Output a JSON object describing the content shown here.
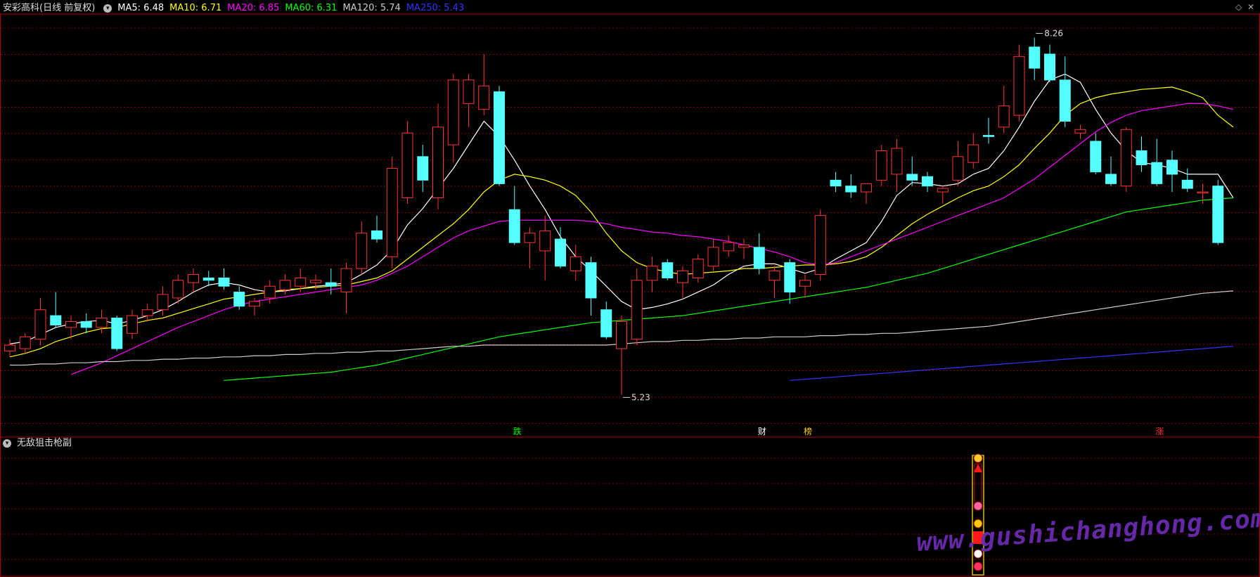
{
  "header": {
    "stock_title": "安彩高科(日线 前复权)",
    "ma_labels": [
      {
        "text": "MA5: 6.48",
        "color": "#ffffff"
      },
      {
        "text": "MA10: 6.71",
        "color": "#ffff00"
      },
      {
        "text": "MA20: 6.85",
        "color": "#ff00ff"
      },
      {
        "text": "MA60: 6.31",
        "color": "#00ff00"
      },
      {
        "text": "MA120: 5.74",
        "color": "#cccccc"
      },
      {
        "text": "MA250: 5.43",
        "color": "#3333ff"
      }
    ]
  },
  "sub_panel": {
    "title": "无敌狙击枪副"
  },
  "watermark": "www.gushichanghong.com",
  "icons": {
    "toggle": "chevron-down-icon",
    "window_controls": [
      "diamond-icon",
      "close-icon"
    ]
  },
  "colors": {
    "up": "#ff3333",
    "down": "#54ffff",
    "grid": "#8b0000",
    "border": "#b00000"
  },
  "chart_data": {
    "type": "candlestick",
    "ylim": [
      5.0,
      8.4
    ],
    "grid": true,
    "annotations": [
      {
        "text": "8.26",
        "note": "high"
      },
      {
        "text": "5.23",
        "note": "low"
      },
      {
        "text": "跌",
        "color": "#00ff00"
      },
      {
        "text": "财",
        "color": "#ffffff"
      },
      {
        "text": "榜",
        "color": "#ffcc00"
      },
      {
        "text": "涨",
        "color": "#ff3333"
      }
    ],
    "candles": [
      {
        "o": 5.6,
        "h": 5.7,
        "l": 5.55,
        "c": 5.65
      },
      {
        "o": 5.62,
        "h": 5.75,
        "l": 5.58,
        "c": 5.72
      },
      {
        "o": 5.7,
        "h": 6.05,
        "l": 5.65,
        "c": 5.95
      },
      {
        "o": 5.9,
        "h": 6.1,
        "l": 5.8,
        "c": 5.82
      },
      {
        "o": 5.8,
        "h": 5.9,
        "l": 5.7,
        "c": 5.85
      },
      {
        "o": 5.85,
        "h": 5.92,
        "l": 5.75,
        "c": 5.8
      },
      {
        "o": 5.8,
        "h": 5.95,
        "l": 5.75,
        "c": 5.88
      },
      {
        "o": 5.88,
        "h": 5.9,
        "l": 5.6,
        "c": 5.62
      },
      {
        "o": 5.75,
        "h": 5.95,
        "l": 5.7,
        "c": 5.9
      },
      {
        "o": 5.9,
        "h": 6.0,
        "l": 5.85,
        "c": 5.95
      },
      {
        "o": 5.95,
        "h": 6.15,
        "l": 5.9,
        "c": 6.08
      },
      {
        "o": 6.05,
        "h": 6.25,
        "l": 6.0,
        "c": 6.2
      },
      {
        "o": 6.18,
        "h": 6.3,
        "l": 6.1,
        "c": 6.25
      },
      {
        "o": 6.22,
        "h": 6.28,
        "l": 6.15,
        "c": 6.2
      },
      {
        "o": 6.22,
        "h": 6.3,
        "l": 6.12,
        "c": 6.15
      },
      {
        "o": 6.1,
        "h": 6.15,
        "l": 5.95,
        "c": 5.98
      },
      {
        "o": 5.98,
        "h": 6.05,
        "l": 5.9,
        "c": 6.02
      },
      {
        "o": 6.05,
        "h": 6.2,
        "l": 6.0,
        "c": 6.15
      },
      {
        "o": 6.12,
        "h": 6.25,
        "l": 6.08,
        "c": 6.2
      },
      {
        "o": 6.15,
        "h": 6.3,
        "l": 6.1,
        "c": 6.22
      },
      {
        "o": 6.18,
        "h": 6.25,
        "l": 6.12,
        "c": 6.2
      },
      {
        "o": 6.18,
        "h": 6.3,
        "l": 6.08,
        "c": 6.15
      },
      {
        "o": 6.1,
        "h": 6.35,
        "l": 5.92,
        "c": 6.3
      },
      {
        "o": 6.3,
        "h": 6.7,
        "l": 6.25,
        "c": 6.6
      },
      {
        "o": 6.62,
        "h": 6.75,
        "l": 6.52,
        "c": 6.55
      },
      {
        "o": 6.4,
        "h": 7.25,
        "l": 6.3,
        "c": 7.15
      },
      {
        "o": 6.9,
        "h": 7.55,
        "l": 6.85,
        "c": 7.45
      },
      {
        "o": 7.25,
        "h": 7.35,
        "l": 6.95,
        "c": 7.05
      },
      {
        "o": 6.9,
        "h": 7.7,
        "l": 6.8,
        "c": 7.5
      },
      {
        "o": 7.35,
        "h": 7.95,
        "l": 7.2,
        "c": 7.9
      },
      {
        "o": 7.7,
        "h": 7.95,
        "l": 7.5,
        "c": 7.9
      },
      {
        "o": 7.65,
        "h": 8.12,
        "l": 7.6,
        "c": 7.85
      },
      {
        "o": 7.8,
        "h": 7.85,
        "l": 7.0,
        "c": 7.02
      },
      {
        "o": 6.8,
        "h": 7.0,
        "l": 6.5,
        "c": 6.52
      },
      {
        "o": 6.52,
        "h": 6.65,
        "l": 6.3,
        "c": 6.6
      },
      {
        "o": 6.45,
        "h": 6.75,
        "l": 6.2,
        "c": 6.62
      },
      {
        "o": 6.55,
        "h": 6.65,
        "l": 6.3,
        "c": 6.32
      },
      {
        "o": 6.28,
        "h": 6.5,
        "l": 6.2,
        "c": 6.4
      },
      {
        "o": 6.35,
        "h": 6.4,
        "l": 5.9,
        "c": 6.05
      },
      {
        "o": 5.95,
        "h": 6.02,
        "l": 5.7,
        "c": 5.72
      },
      {
        "o": 5.62,
        "h": 5.9,
        "l": 5.23,
        "c": 5.85
      },
      {
        "o": 5.7,
        "h": 6.3,
        "l": 5.65,
        "c": 6.2
      },
      {
        "o": 6.2,
        "h": 6.4,
        "l": 6.1,
        "c": 6.32
      },
      {
        "o": 6.35,
        "h": 6.38,
        "l": 6.2,
        "c": 6.22
      },
      {
        "o": 6.18,
        "h": 6.32,
        "l": 6.05,
        "c": 6.28
      },
      {
        "o": 6.22,
        "h": 6.42,
        "l": 6.18,
        "c": 6.38
      },
      {
        "o": 6.32,
        "h": 6.55,
        "l": 6.28,
        "c": 6.48
      },
      {
        "o": 6.45,
        "h": 6.58,
        "l": 6.4,
        "c": 6.52
      },
      {
        "o": 6.48,
        "h": 6.55,
        "l": 6.38,
        "c": 6.5
      },
      {
        "o": 6.48,
        "h": 6.6,
        "l": 6.25,
        "c": 6.3
      },
      {
        "o": 6.2,
        "h": 6.32,
        "l": 6.05,
        "c": 6.28
      },
      {
        "o": 6.35,
        "h": 6.38,
        "l": 6.0,
        "c": 6.1
      },
      {
        "o": 6.15,
        "h": 6.25,
        "l": 6.05,
        "c": 6.2
      },
      {
        "o": 6.25,
        "h": 6.8,
        "l": 6.2,
        "c": 6.75
      },
      {
        "o": 7.05,
        "h": 7.12,
        "l": 6.95,
        "c": 7.0
      },
      {
        "o": 7.0,
        "h": 7.1,
        "l": 6.9,
        "c": 6.95
      },
      {
        "o": 6.95,
        "h": 7.0,
        "l": 6.85,
        "c": 7.02
      },
      {
        "o": 7.05,
        "h": 7.35,
        "l": 7.0,
        "c": 7.3
      },
      {
        "o": 7.1,
        "h": 7.4,
        "l": 6.95,
        "c": 7.32
      },
      {
        "o": 7.1,
        "h": 7.25,
        "l": 7.0,
        "c": 7.05
      },
      {
        "o": 7.08,
        "h": 7.12,
        "l": 6.95,
        "c": 7.0
      },
      {
        "o": 6.95,
        "h": 7.0,
        "l": 6.85,
        "c": 6.98
      },
      {
        "o": 7.05,
        "h": 7.38,
        "l": 7.0,
        "c": 7.25
      },
      {
        "o": 7.2,
        "h": 7.45,
        "l": 7.15,
        "c": 7.35
      },
      {
        "o": 7.43,
        "h": 7.58,
        "l": 7.36,
        "c": 7.42
      },
      {
        "o": 7.5,
        "h": 7.85,
        "l": 7.45,
        "c": 7.68
      },
      {
        "o": 7.6,
        "h": 8.2,
        "l": 7.55,
        "c": 8.1
      },
      {
        "o": 8.18,
        "h": 8.26,
        "l": 7.9,
        "c": 8.0
      },
      {
        "o": 8.12,
        "h": 8.2,
        "l": 7.88,
        "c": 7.9
      },
      {
        "o": 7.9,
        "h": 8.1,
        "l": 7.5,
        "c": 7.55
      },
      {
        "o": 7.45,
        "h": 7.52,
        "l": 7.4,
        "c": 7.48
      },
      {
        "o": 7.38,
        "h": 7.45,
        "l": 7.1,
        "c": 7.12
      },
      {
        "o": 7.1,
        "h": 7.25,
        "l": 7.0,
        "c": 7.02
      },
      {
        "o": 7.0,
        "h": 7.5,
        "l": 6.95,
        "c": 7.48
      },
      {
        "o": 7.3,
        "h": 7.42,
        "l": 7.12,
        "c": 7.18
      },
      {
        "o": 7.2,
        "h": 7.4,
        "l": 7.0,
        "c": 7.02
      },
      {
        "o": 7.22,
        "h": 7.3,
        "l": 6.95,
        "c": 7.1
      },
      {
        "o": 7.05,
        "h": 7.15,
        "l": 6.95,
        "c": 6.98
      },
      {
        "o": 6.95,
        "h": 7.02,
        "l": 6.85,
        "c": 6.95
      },
      {
        "o": 7.0,
        "h": 7.05,
        "l": 6.5,
        "c": 6.52
      }
    ],
    "series": [
      {
        "name": "MA5",
        "color": "#ffffff",
        "values": [
          5.66,
          5.68,
          5.74,
          5.8,
          5.83,
          5.85,
          5.86,
          5.83,
          5.86,
          5.9,
          5.95,
          6.02,
          6.1,
          6.16,
          6.18,
          6.16,
          6.12,
          6.1,
          6.11,
          6.13,
          6.15,
          6.16,
          6.18,
          6.25,
          6.33,
          6.46,
          6.67,
          6.81,
          6.98,
          7.15,
          7.35,
          7.55,
          7.42,
          7.22,
          7.0,
          6.8,
          6.57,
          6.4,
          6.28,
          6.15,
          6.02,
          5.95,
          5.97,
          6.0,
          6.04,
          6.1,
          6.16,
          6.25,
          6.32,
          6.34,
          6.34,
          6.3,
          6.26,
          6.3,
          6.38,
          6.45,
          6.52,
          6.7,
          6.92,
          7.03,
          7.02,
          7.0,
          7.02,
          7.1,
          7.15,
          7.3,
          7.5,
          7.72,
          7.9,
          7.95,
          7.88,
          7.65,
          7.45,
          7.3,
          7.2,
          7.18,
          7.15,
          7.1,
          7.1,
          7.1,
          6.9
        ]
      },
      {
        "name": "MA10",
        "color": "#ffff00",
        "values": [
          5.55,
          5.58,
          5.62,
          5.68,
          5.72,
          5.76,
          5.79,
          5.8,
          5.83,
          5.86,
          5.88,
          5.92,
          5.96,
          6.0,
          6.04,
          6.06,
          6.08,
          6.1,
          6.12,
          6.13,
          6.14,
          6.15,
          6.16,
          6.19,
          6.22,
          6.28,
          6.38,
          6.48,
          6.58,
          6.68,
          6.8,
          6.95,
          7.05,
          7.1,
          7.08,
          7.05,
          7.0,
          6.92,
          6.78,
          6.6,
          6.45,
          6.35,
          6.3,
          6.27,
          6.25,
          6.26,
          6.27,
          6.28,
          6.3,
          6.3,
          6.31,
          6.32,
          6.33,
          6.33,
          6.34,
          6.36,
          6.4,
          6.48,
          6.58,
          6.68,
          6.76,
          6.83,
          6.9,
          6.96,
          7.0,
          7.08,
          7.18,
          7.32,
          7.45,
          7.6,
          7.7,
          7.75,
          7.78,
          7.8,
          7.82,
          7.83,
          7.84,
          7.8,
          7.75,
          7.6,
          7.5
        ]
      },
      {
        "name": "MA20",
        "color": "#ff00ff",
        "values": [
          null,
          null,
          null,
          null,
          5.4,
          5.45,
          5.5,
          5.56,
          5.62,
          5.68,
          5.74,
          5.8,
          5.85,
          5.9,
          5.95,
          5.99,
          6.02,
          6.04,
          6.06,
          6.08,
          6.1,
          6.12,
          6.14,
          6.16,
          6.2,
          6.26,
          6.32,
          6.4,
          6.48,
          6.56,
          6.62,
          6.66,
          6.7,
          6.71,
          6.71,
          6.71,
          6.71,
          6.71,
          6.7,
          6.68,
          6.65,
          6.63,
          6.61,
          6.6,
          6.58,
          6.57,
          6.55,
          6.53,
          6.5,
          6.47,
          6.44,
          6.4,
          6.35,
          6.33,
          6.35,
          6.4,
          6.45,
          6.5,
          6.55,
          6.6,
          6.65,
          6.7,
          6.75,
          6.8,
          6.85,
          6.9,
          6.98,
          7.06,
          7.16,
          7.26,
          7.36,
          7.46,
          7.54,
          7.6,
          7.64,
          7.66,
          7.68,
          7.7,
          7.7,
          7.68,
          7.65
        ]
      },
      {
        "name": "MA60",
        "color": "#00ff00",
        "values": [
          null,
          null,
          null,
          null,
          null,
          null,
          null,
          null,
          null,
          null,
          null,
          null,
          null,
          null,
          5.35,
          5.36,
          5.37,
          5.38,
          5.39,
          5.4,
          5.41,
          5.42,
          5.44,
          5.46,
          5.48,
          5.51,
          5.54,
          5.57,
          5.6,
          5.63,
          5.66,
          5.69,
          5.72,
          5.74,
          5.76,
          5.78,
          5.8,
          5.82,
          5.84,
          5.85,
          5.86,
          5.87,
          5.88,
          5.89,
          5.9,
          5.92,
          5.94,
          5.96,
          5.98,
          6.0,
          6.02,
          6.04,
          6.06,
          6.08,
          6.1,
          6.12,
          6.14,
          6.17,
          6.2,
          6.23,
          6.26,
          6.3,
          6.34,
          6.38,
          6.42,
          6.46,
          6.5,
          6.54,
          6.58,
          6.62,
          6.66,
          6.7,
          6.74,
          6.78,
          6.8,
          6.82,
          6.84,
          6.86,
          6.88,
          6.89,
          6.9
        ]
      },
      {
        "name": "MA120",
        "color": "#cccccc",
        "values": [
          5.48,
          5.48,
          5.49,
          5.49,
          5.5,
          5.5,
          5.51,
          5.51,
          5.52,
          5.52,
          5.53,
          5.53,
          5.54,
          5.54,
          5.55,
          5.55,
          5.56,
          5.56,
          5.57,
          5.57,
          5.58,
          5.58,
          5.59,
          5.59,
          5.6,
          5.6,
          5.61,
          5.62,
          5.63,
          5.64,
          5.64,
          5.65,
          5.65,
          5.65,
          5.65,
          5.65,
          5.65,
          5.65,
          5.65,
          5.65,
          5.66,
          5.67,
          5.68,
          5.68,
          5.69,
          5.69,
          5.7,
          5.7,
          5.71,
          5.71,
          5.72,
          5.72,
          5.72,
          5.73,
          5.73,
          5.74,
          5.74,
          5.75,
          5.75,
          5.76,
          5.77,
          5.78,
          5.79,
          5.8,
          5.81,
          5.83,
          5.85,
          5.87,
          5.89,
          5.91,
          5.93,
          5.95,
          5.97,
          5.99,
          6.01,
          6.03,
          6.05,
          6.07,
          6.09,
          6.1,
          6.11
        ]
      },
      {
        "name": "MA250",
        "color": "#3333ff",
        "values": [
          null,
          null,
          null,
          null,
          null,
          null,
          null,
          null,
          null,
          null,
          null,
          null,
          null,
          null,
          null,
          null,
          null,
          null,
          null,
          null,
          null,
          null,
          null,
          null,
          null,
          null,
          null,
          null,
          null,
          null,
          null,
          null,
          null,
          null,
          null,
          null,
          null,
          null,
          null,
          null,
          null,
          null,
          null,
          null,
          null,
          null,
          null,
          null,
          null,
          null,
          null,
          5.35,
          5.36,
          5.37,
          5.38,
          5.39,
          5.4,
          5.41,
          5.42,
          5.43,
          5.44,
          5.45,
          5.46,
          5.47,
          5.48,
          5.49,
          5.5,
          5.51,
          5.52,
          5.53,
          5.54,
          5.55,
          5.56,
          5.57,
          5.58,
          5.59,
          5.6,
          5.61,
          5.62,
          5.63,
          5.64
        ]
      }
    ]
  }
}
